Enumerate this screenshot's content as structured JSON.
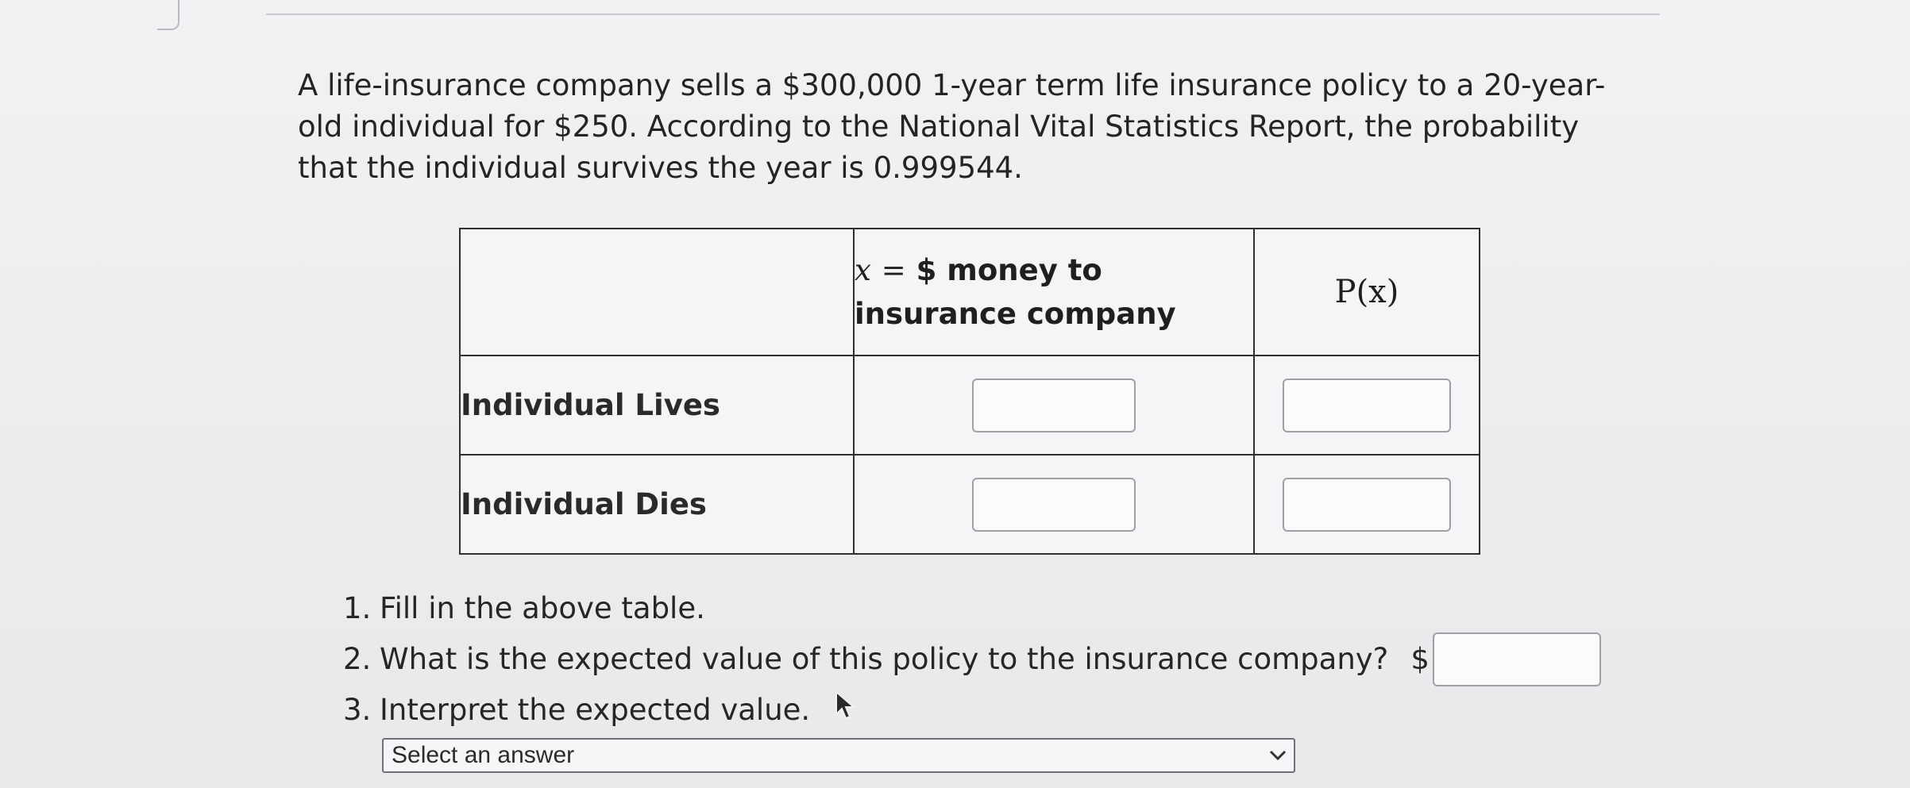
{
  "question": {
    "text": "A life-insurance company sells a $300,000 1-year term life insurance policy to a 20-year-old individual for $250. According to the National Vital Statistics Report, the probability that the individual survives the year is 0.999544."
  },
  "table": {
    "header_col1_math": "x",
    "header_col1_eq": "=",
    "header_col1_text_a": "$ money to",
    "header_col1_text_b": "insurance company",
    "header_col2": "P(x)",
    "rows": [
      {
        "label": "Individual Lives",
        "x_value": "",
        "p_value": ""
      },
      {
        "label": "Individual Dies",
        "x_value": "",
        "p_value": ""
      }
    ]
  },
  "instructions": [
    {
      "num": "1.",
      "text": "Fill in the above table."
    },
    {
      "num": "2.",
      "text": "What is the expected value of this policy to the insurance company?",
      "prefix": "$",
      "value": ""
    },
    {
      "num": "3.",
      "text": "Interpret the expected value."
    }
  ],
  "interpret_select": {
    "selected": "Select an answer"
  },
  "icons": {
    "cursor": "mouse-pointer-icon",
    "dropdown": "chevron-down-icon"
  }
}
